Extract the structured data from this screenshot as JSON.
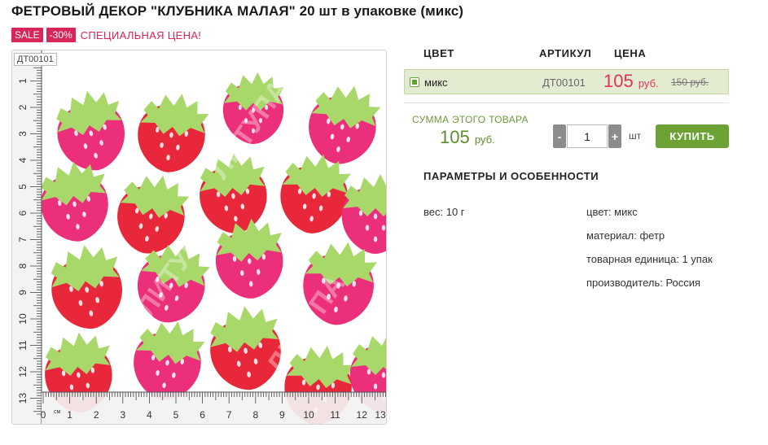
{
  "product": {
    "title": "ФЕТРОВЫЙ ДЕКОР \"КЛУБНИКА МАЛАЯ\" 20 шт в упаковке (микс)",
    "sale_badge": "SALE",
    "discount_badge": "-30%",
    "special_price_text": "СПЕЦИАЛЬНАЯ ЦЕНА!",
    "image_code": "ДТ00101",
    "watermark": "ЛИТУПА"
  },
  "ruler": {
    "vertical_labels": [
      "1",
      "2",
      "3",
      "4",
      "5",
      "6",
      "7",
      "8",
      "9",
      "10",
      "11",
      "12",
      "13"
    ],
    "horizontal_labels": [
      "0",
      "1",
      "2",
      "3",
      "4",
      "5",
      "6",
      "7",
      "8",
      "9",
      "10",
      "11",
      "12",
      "13"
    ],
    "unit": "см"
  },
  "table": {
    "headers": {
      "color": "ЦВЕТ",
      "sku": "АРТИКУЛ",
      "price": "ЦЕНА"
    },
    "row": {
      "color": "микс",
      "sku": "ДТ00101",
      "price": "105",
      "currency": "руб.",
      "old_price": "150 руб."
    }
  },
  "summary": {
    "label": "СУММА ЭТОГО ТОВАРА",
    "value": "105",
    "currency": "руб."
  },
  "quantity": {
    "minus": "-",
    "value": "1",
    "plus": "+",
    "unit": "шт"
  },
  "buy_button": "КУПИТЬ",
  "params": {
    "title": "ПАРАМЕТРЫ И ОСОБЕННОСТИ",
    "weight": "вес: 10 г",
    "color": "цвет: микс",
    "material": "материал: фетр",
    "unit": "товарная единица: 1 упак",
    "manufacturer": "производитель: Россия"
  },
  "colors": {
    "sale": "#d8265b",
    "price": "#e0305f",
    "accent_green": "#6ca234",
    "row_bg": "#e3ecd1",
    "strawberry_red": "#e8283a",
    "strawberry_pink": "#ec2f7a",
    "leaf": "#a8d86a"
  }
}
